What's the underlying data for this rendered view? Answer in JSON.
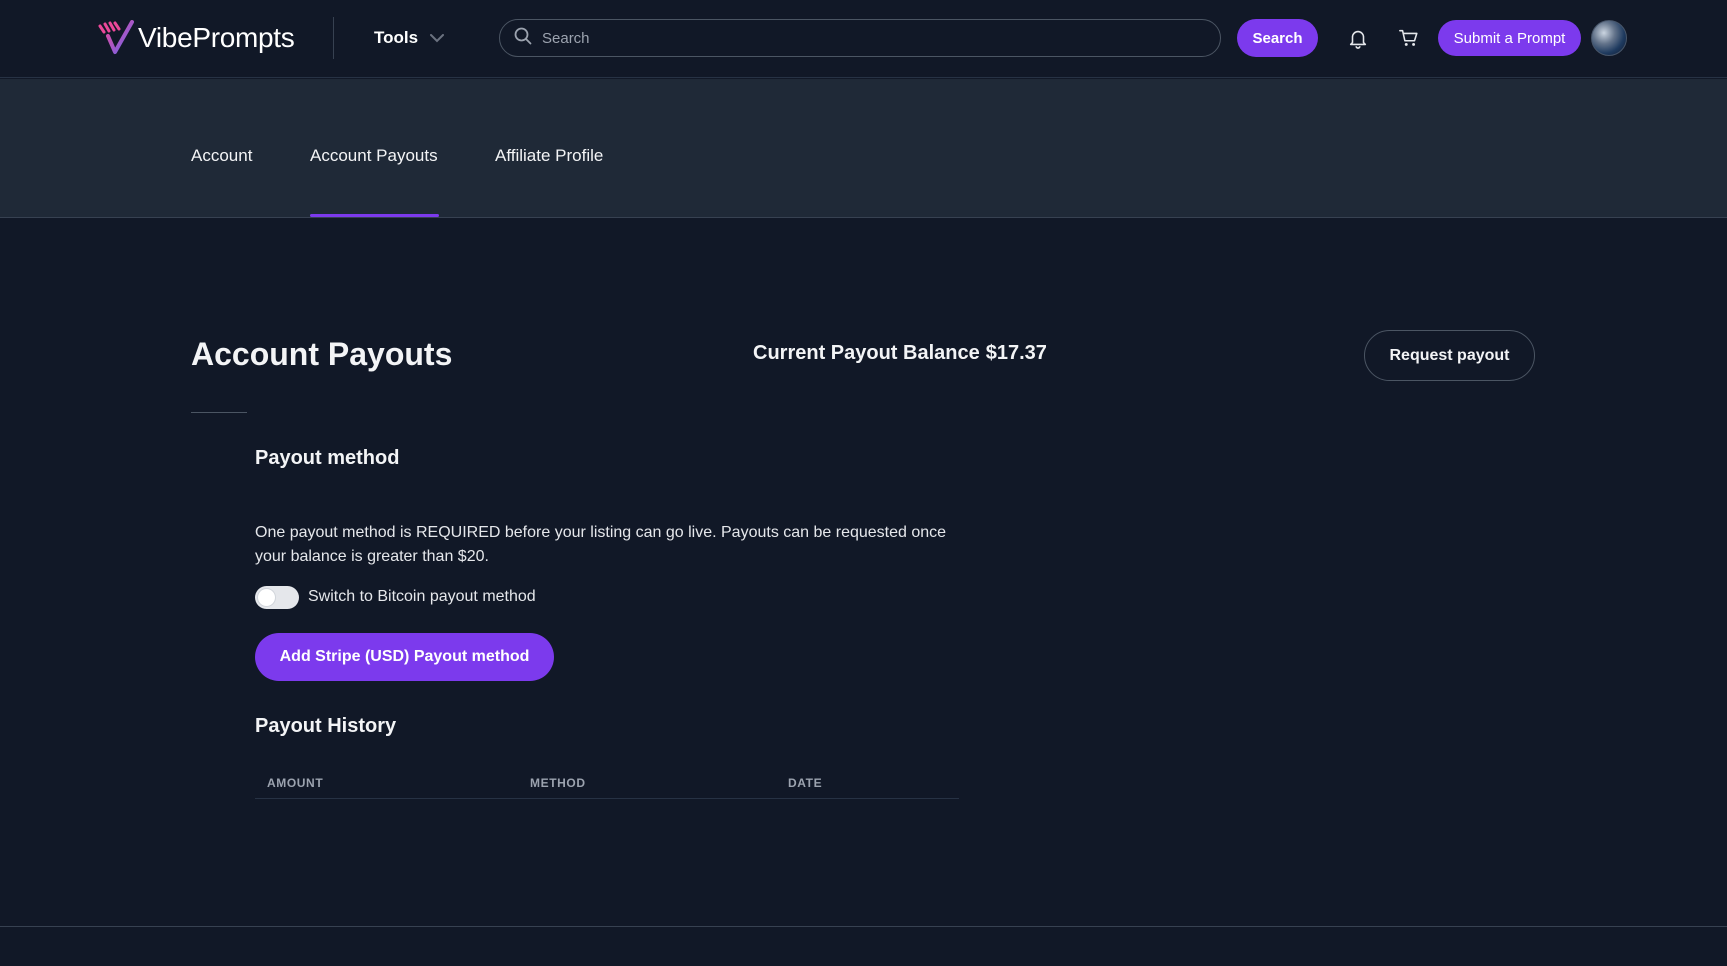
{
  "header": {
    "logo_text": "VibePrompts",
    "tools_label": "Tools",
    "search_placeholder": "Search",
    "search_button": "Search",
    "submit_button": "Submit a Prompt"
  },
  "tabs": [
    {
      "label": "Account",
      "active": false
    },
    {
      "label": "Account Payouts",
      "active": true
    },
    {
      "label": "Affiliate Profile",
      "active": false
    }
  ],
  "main": {
    "title": "Account Payouts",
    "balance_label": "Current Payout Balance",
    "balance_value": "$17.37",
    "request_button": "Request payout",
    "payout_method": {
      "heading": "Payout method",
      "description": "One payout method is REQUIRED before your listing can go live. Payouts can be requested once your balance is greater than $20.",
      "toggle_label": "Switch to Bitcoin payout method",
      "toggle_on": false,
      "add_button": "Add Stripe (USD) Payout method"
    },
    "payout_history": {
      "heading": "Payout History",
      "columns": [
        "AMOUNT",
        "METHOD",
        "DATE"
      ],
      "rows": []
    }
  },
  "colors": {
    "background": "#111827",
    "band": "#1f2937",
    "accent": "#7c3aed"
  },
  "icons": [
    "vibeprompts-logo-icon",
    "chevron-down-icon",
    "search-icon",
    "bell-icon",
    "cart-icon",
    "avatar"
  ]
}
